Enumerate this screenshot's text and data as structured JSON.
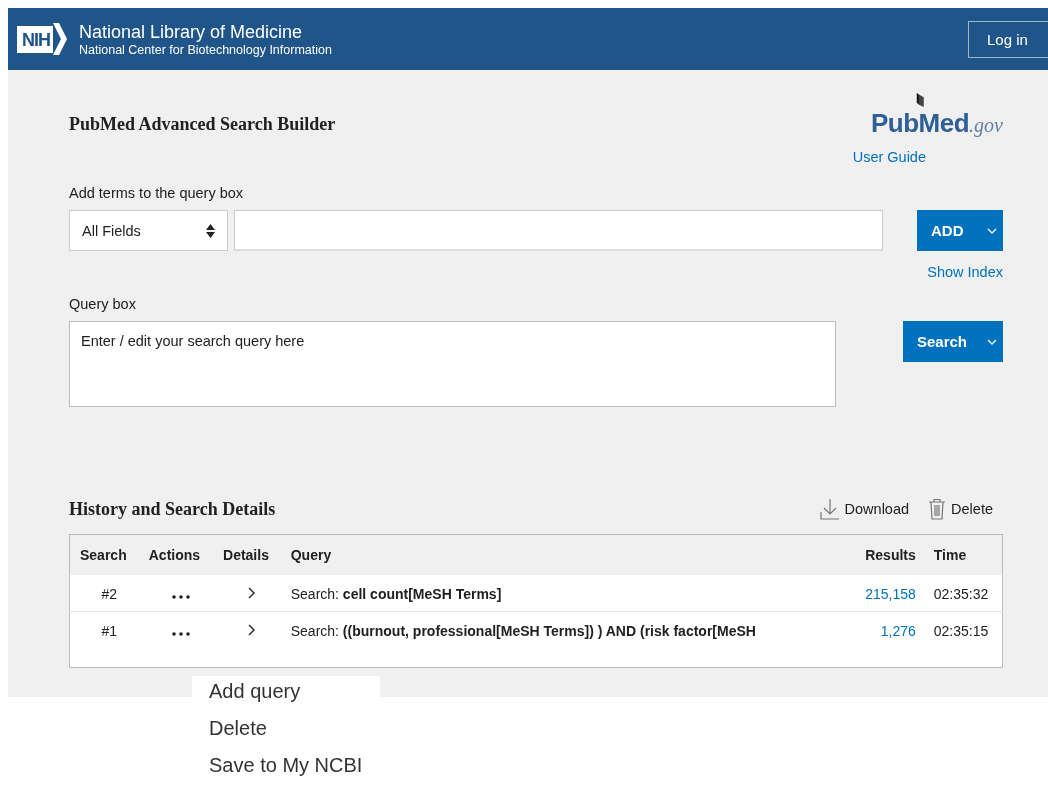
{
  "header": {
    "org": "National Library of Medicine",
    "suborg": "National Center for Biotechnology Information",
    "login": "Log in",
    "badge": "NIH"
  },
  "builder": {
    "title": "PubMed Advanced Search Builder",
    "logo": "PubMed",
    "logo_suffix": ".gov",
    "user_guide": "User Guide",
    "add_label": "Add terms to the query box",
    "field_select": "All Fields",
    "add_button": "ADD",
    "show_index": "Show Index",
    "query_label": "Query box",
    "query_placeholder": "Enter / edit your search query here",
    "search_button": "Search"
  },
  "history": {
    "title": "History and Search Details",
    "download": "Download",
    "delete": "Delete",
    "columns": [
      "Search",
      "Actions",
      "Details",
      "Query",
      "Results",
      "Time"
    ],
    "rows": [
      {
        "search": "#2",
        "query": "Search: **cell count[MeSH Terms]**",
        "results": "215,158",
        "time": "02:35:32"
      },
      {
        "search": "#1",
        "query": "Search: **((burnout, professional[MeSH Terms]) ) AND (risk factor[MeSH**",
        "results": "1,276",
        "time": "02:35:15"
      }
    ]
  },
  "actions_menu": [
    "Add query",
    "Delete",
    "Save to My NCBI"
  ]
}
